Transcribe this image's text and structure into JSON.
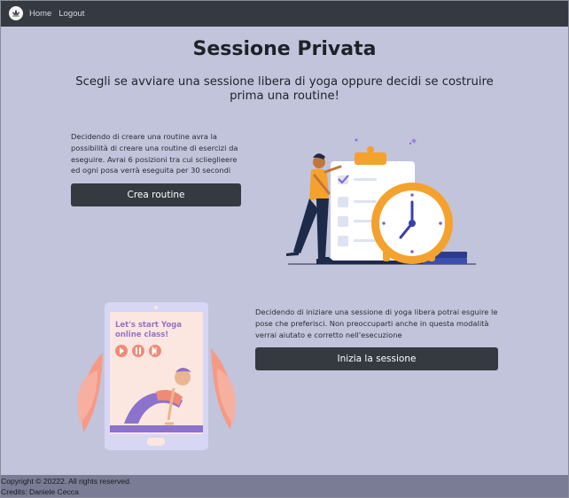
{
  "nav": {
    "logo_icon": "lotus-logo-icon",
    "home": "Home",
    "logout": "Logout"
  },
  "page": {
    "title": "Sessione Privata",
    "subtitle": "Scegli se avviare una sessione libera di yoga oppure decidi se costruire prima una routine!"
  },
  "routine": {
    "description": "Decidendo di creare una routine avra la possibilità di creare una routine di esercizi da eseguire. Avrai 6 posizioni tra cui sclieglieere ed ogni posa verrà eseguita per 30 secondi",
    "button": "Crea routine",
    "illustration": "checklist-clock-illustration"
  },
  "free_session": {
    "description": "Decidendo di iniziare una sessione di yoga libera potrai esguire le pose che preferisci. Non preoccuparti anche in questa modalità verrai aiutato e corretto nell'esecuzione",
    "button": "Inizia la sessione",
    "illustration": "tablet-yoga-class-illustration",
    "tablet_text": "Let's start Yoga online class!"
  },
  "footer": {
    "copyright": "Copyright © 20222. All rights reserved.",
    "credits": "Credits: Daniele Cecca"
  },
  "colors": {
    "background": "#c2c4dc",
    "navbar": "#343a40",
    "button": "#343a40",
    "footer": "#7a7c95",
    "clock": "#f4a22d",
    "accent_purple": "#8a6fd8"
  }
}
